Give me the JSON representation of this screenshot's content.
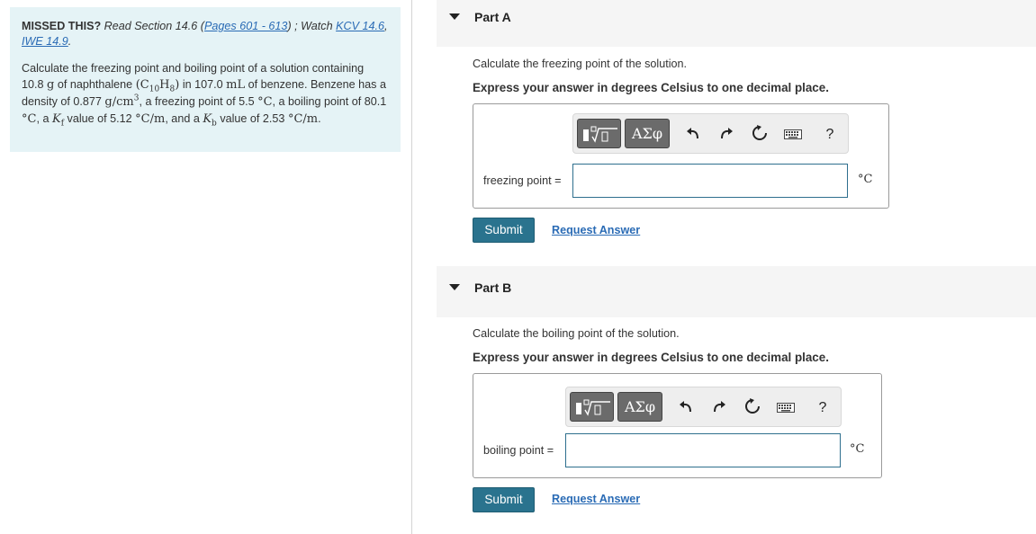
{
  "intro": {
    "missed_label": "MISSED THIS?",
    "read_text": "Read Section 14.6 (",
    "pages_link": "Pages 601 - 613",
    "watch_text": ") ; Watch",
    "kcv_link": "KCV 14.6",
    "iwe_link": "IWE 14.9",
    "end_text": ".",
    "problem": {
      "t1": "Calculate the freezing point and boiling point of a solution containing",
      "mass_value": "10.8",
      "mass_unit": "g",
      "t2": "of naphthalene",
      "formula_open": "(C",
      "formula_sub1": "10",
      "formula_mid": "H",
      "formula_sub2": "8",
      "formula_close": ")",
      "t3": "in 107.0",
      "vol_unit": "mL",
      "t4": "of benzene. Benzene has a density of 0.877",
      "density_unit": "g/cm",
      "density_sup": "3",
      "t5": ", a freezing point of 5.5",
      "deg_c": "°C",
      "t6": ", a boiling point of 80.1",
      "t7": ", a",
      "kf_sym": "K",
      "kf_sub": "f",
      "t8": "value of 5.12",
      "kunit": "°C/m",
      "t9": ", and a",
      "kb_sym": "K",
      "kb_sub": "b",
      "t10": "value of 2.53",
      "t11": "."
    }
  },
  "partA": {
    "title": "Part A",
    "instruction": "Calculate the freezing point of the solution.",
    "express": "Express your answer in degrees Celsius to one decimal place.",
    "greek_label": "ΑΣφ",
    "help": "?",
    "field_label": "freezing point =",
    "value": "",
    "unit": "°C",
    "submit": "Submit",
    "request": "Request Answer"
  },
  "partB": {
    "title": "Part B",
    "instruction": "Calculate the boiling point of the solution.",
    "express": "Express your answer in degrees Celsius to one decimal place.",
    "greek_label": "ΑΣφ",
    "help": "?",
    "field_label": "boiling point =",
    "value": "",
    "unit": "°C",
    "submit": "Submit",
    "request": "Request Answer"
  },
  "colors": {
    "intro_bg": "#e5f3f6",
    "link": "#2a6bb5",
    "submit_bg": "#2a738e",
    "input_border": "#2e6f8e"
  }
}
